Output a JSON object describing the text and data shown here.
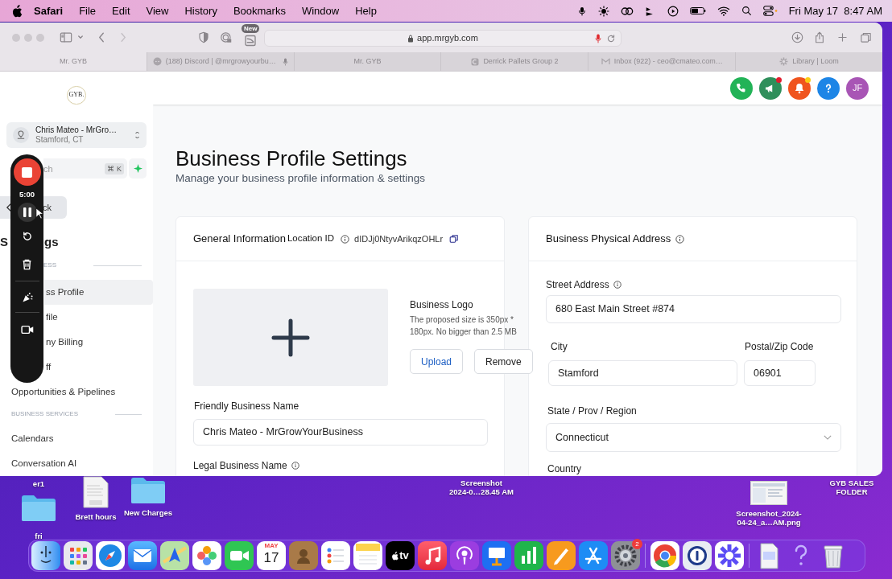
{
  "menu_bar": {
    "app": "Safari",
    "menus": [
      "File",
      "Edit",
      "View",
      "History",
      "Bookmarks",
      "Window",
      "Help"
    ],
    "clock": "Fri May 17  8:47 AM"
  },
  "toolbar": {
    "badge": "New",
    "url": "app.mrgyb.com"
  },
  "tabs": [
    {
      "label": "Mr. GYB",
      "kind": "plain",
      "mic": false,
      "selected": true
    },
    {
      "label": "(188) Discord | @mrgrowyourbu…",
      "kind": "chat",
      "mic": true,
      "selected": false
    },
    {
      "label": "Mr. GYB",
      "kind": "plain",
      "mic": false,
      "selected": false
    },
    {
      "label": "Derrick Pallets Group 2",
      "kind": "letter",
      "mic": false,
      "selected": false
    },
    {
      "label": "Inbox (922) - ceo@cmateo.com…",
      "kind": "mail",
      "mic": false,
      "selected": false
    },
    {
      "label": "Library | Loom",
      "kind": "burst",
      "mic": false,
      "selected": false
    }
  ],
  "sidebar": {
    "logo": "GYB.",
    "account": {
      "name": "Chris Mateo - MrGro…",
      "location": "Stamford, CT"
    },
    "search": {
      "placeholder": "ch",
      "shortcut": "⌘ K"
    },
    "back": "ck",
    "heading": [
      "S",
      "gs"
    ],
    "sections": [
      {
        "label": "ESS",
        "kind": "partial",
        "items": [
          {
            "label": "ss Profile",
            "kind": "partial",
            "selected": true
          },
          {
            "label": "file",
            "kind": "partial",
            "selected": false
          },
          {
            "label": "ny Billing",
            "kind": "partial",
            "selected": false
          },
          {
            "label": "ff",
            "kind": "partial",
            "selected": false
          },
          {
            "label": "Opportunities & Pipelines",
            "kind": "full",
            "selected": false
          }
        ]
      },
      {
        "label": "BUSINESS SERVICES",
        "kind": "full",
        "items": [
          {
            "label": "Calendars",
            "kind": "full",
            "selected": false
          },
          {
            "label": "Conversation AI",
            "kind": "full",
            "selected": false
          }
        ]
      }
    ]
  },
  "recorder": {
    "time": "5:00"
  },
  "header_buttons": [
    {
      "kind": "phone"
    },
    {
      "kind": "megaphone",
      "dot": {
        "color": "#e11d2e"
      }
    },
    {
      "kind": "bell",
      "dot": {
        "color": "#facc15"
      }
    },
    {
      "kind": "help"
    },
    {
      "kind": "avatar",
      "initials": "JF"
    }
  ],
  "page": {
    "title": "Business Profile Settings",
    "subtitle": "Manage your business profile information & settings",
    "general": {
      "title": "General Information",
      "location_label": "Location ID",
      "location_id": "dIDJj0NtyvArikqzOHLr",
      "logo_label": "Business Logo",
      "logo_hint": "The proposed size is 350px * 180px. No bigger than 2.5 MB",
      "buttons": [
        "Upload",
        "Remove"
      ],
      "fields": [
        {
          "label": "Friendly Business Name",
          "value": "Chris Mateo - MrGrowYourBusiness",
          "info": false
        },
        {
          "label": "Legal Business Name",
          "info": true
        }
      ]
    },
    "address": {
      "title": "Business Physical Address",
      "street": {
        "label": "Street Address",
        "value": "680 East Main Street #874"
      },
      "city": {
        "label": "City",
        "value": "Stamford"
      },
      "zip": {
        "label": "Postal/Zip Code",
        "value": "06901"
      },
      "state": {
        "label": "State / Prov / Region",
        "value": "Connecticut"
      },
      "country": {
        "label": "Country"
      }
    }
  },
  "desktop": [
    {
      "kind": "label",
      "lines": [
        "er1"
      ]
    },
    {
      "kind": "folder",
      "lines": [
        "fri"
      ]
    },
    {
      "kind": "document",
      "lines": [
        "Brett hours"
      ]
    },
    {
      "kind": "folder",
      "lines": [
        "New Charges"
      ]
    },
    {
      "kind": "label",
      "lines": [
        "Screenshot",
        "2024-0…28.45 AM"
      ]
    },
    {
      "kind": "image",
      "lines": [
        "Screenshot_2024-",
        "04-24_a…AM.png"
      ]
    },
    {
      "kind": "label",
      "lines": [
        "GYB SALES",
        "FOLDER"
      ]
    }
  ],
  "dock": [
    {
      "kind": "finder"
    },
    {
      "kind": "launchpad"
    },
    {
      "kind": "safari"
    },
    {
      "kind": "mail"
    },
    {
      "kind": "maps"
    },
    {
      "kind": "photos"
    },
    {
      "kind": "facetime"
    },
    {
      "kind": "calendar",
      "month": "MAY",
      "day": "17"
    },
    {
      "kind": "contacts"
    },
    {
      "kind": "reminders"
    },
    {
      "kind": "notes"
    },
    {
      "kind": "tv",
      "label": "tv"
    },
    {
      "kind": "music"
    },
    {
      "kind": "podcasts"
    },
    {
      "kind": "keynote"
    },
    {
      "kind": "numbers"
    },
    {
      "kind": "pages"
    },
    {
      "kind": "appstore"
    },
    {
      "kind": "settings",
      "badge": "2"
    },
    {
      "kind": "separator"
    },
    {
      "kind": "chrome"
    },
    {
      "kind": "password"
    },
    {
      "kind": "loom"
    },
    {
      "kind": "separator"
    },
    {
      "kind": "file"
    },
    {
      "kind": "question"
    },
    {
      "kind": "trash"
    }
  ]
}
